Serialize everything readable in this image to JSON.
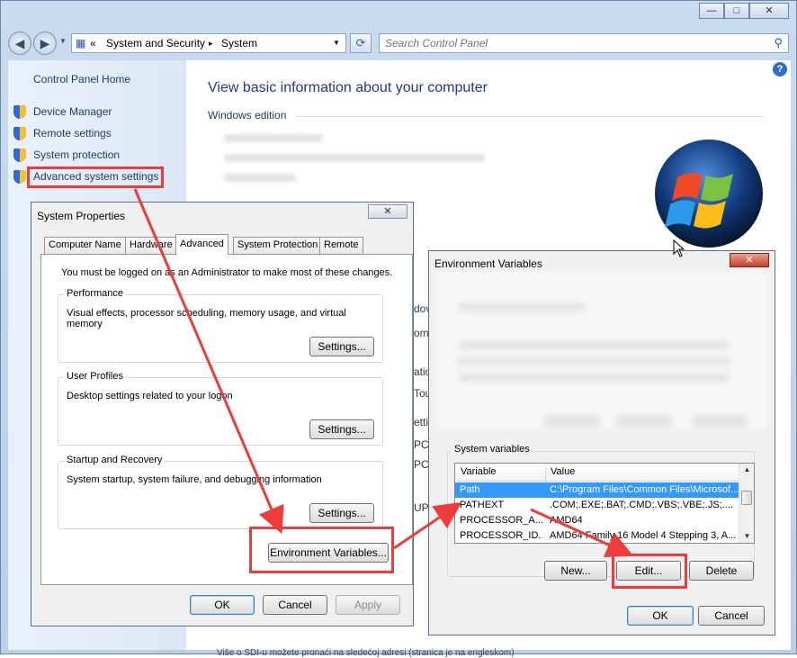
{
  "window": {
    "buttons": {
      "minimize": "—",
      "maximize": "□",
      "close": "✕"
    }
  },
  "address_bar": {
    "prefix": "«",
    "crumbs": [
      "System and Security",
      "System"
    ],
    "separator": "▸",
    "search_placeholder": "Search Control Panel"
  },
  "sidebar": {
    "home": "Control Panel Home",
    "items": [
      {
        "label": "Device Manager"
      },
      {
        "label": "Remote settings"
      },
      {
        "label": "System protection"
      },
      {
        "label": "Advanced system settings"
      }
    ]
  },
  "main": {
    "title": "View basic information about your computer",
    "section": "Windows edition",
    "peek_lines": [
      "dov",
      "om",
      "atio",
      "Tou",
      "etti",
      "PC",
      "PC",
      "UP"
    ]
  },
  "bottom_text": "Više o SDI-u možete pronaći na sledećoj adresi (stranica je na engleskom)",
  "system_properties": {
    "title": "System Properties",
    "tabs": [
      "Computer Name",
      "Hardware",
      "Advanced",
      "System Protection",
      "Remote"
    ],
    "active_tab": "Advanced",
    "admin_note": "You must be logged on as an Administrator to make most of these changes.",
    "groups": [
      {
        "caption": "Performance",
        "desc": "Visual effects, processor scheduling, memory usage, and virtual memory",
        "button": "Settings..."
      },
      {
        "caption": "User Profiles",
        "desc": "Desktop settings related to your logon",
        "button": "Settings..."
      },
      {
        "caption": "Startup and Recovery",
        "desc": "System startup, system failure, and debugging information",
        "button": "Settings..."
      }
    ],
    "env_button": "Environment Variables...",
    "ok": "OK",
    "cancel": "Cancel",
    "apply": "Apply"
  },
  "env_vars": {
    "title": "Environment Variables",
    "sys_group": "System variables",
    "columns": [
      "Variable",
      "Value"
    ],
    "rows": [
      {
        "var": "Path",
        "val": "C:\\Program Files\\Common Files\\Microsof...",
        "selected": true
      },
      {
        "var": "PATHEXT",
        "val": ".COM;.EXE;.BAT;.CMD;.VBS;.VBE;.JS;....",
        "selected": false
      },
      {
        "var": "PROCESSOR_A...",
        "val": "AMD64",
        "selected": false
      },
      {
        "var": "PROCESSOR_ID...",
        "val": "AMD64 Family 16 Model 4 Stepping 3, A...",
        "selected": false
      }
    ],
    "new": "New...",
    "edit": "Edit...",
    "delete": "Delete",
    "ok": "OK",
    "cancel": "Cancel"
  },
  "colors": {
    "highlight": "#ee3b3b",
    "selection": "#3399ff",
    "link": "#1e3a5f"
  }
}
